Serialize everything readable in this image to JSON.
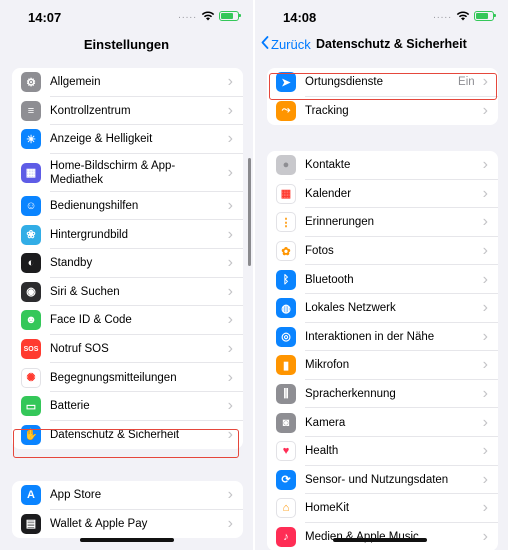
{
  "left": {
    "status": {
      "time": "14:07",
      "signal": "....."
    },
    "title": "Einstellungen",
    "group1": [
      {
        "label": "Allgemein",
        "icon": "gear-icon",
        "color": "#8e8e93"
      },
      {
        "label": "Kontrollzentrum",
        "icon": "toggles-icon",
        "color": "#8e8e93"
      },
      {
        "label": "Anzeige & Helligkeit",
        "icon": "sun-icon",
        "color": "#0a84ff"
      },
      {
        "label": "Home-Bildschirm & App-Mediathek",
        "icon": "app-grid-icon",
        "color": "#5e5ce6"
      },
      {
        "label": "Bedienungshilfen",
        "icon": "accessibility-icon",
        "color": "#0a84ff"
      },
      {
        "label": "Hintergrundbild",
        "icon": "flower-icon",
        "color": "#32ade6"
      },
      {
        "label": "Standby",
        "icon": "standby-icon",
        "color": "#1c1c1e"
      },
      {
        "label": "Siri & Suchen",
        "icon": "siri-icon",
        "color": "#2c2c2e"
      },
      {
        "label": "Face ID & Code",
        "icon": "face-id-icon",
        "color": "#34c759"
      },
      {
        "label": "Notruf SOS",
        "icon": "sos-icon",
        "color": "#ff3b30",
        "glyph": "SOS"
      },
      {
        "label": "Begegnungsmitteilungen",
        "icon": "exposure-icon",
        "color": "#ffffff"
      },
      {
        "label": "Batterie",
        "icon": "battery-icon",
        "color": "#34c759"
      },
      {
        "label": "Datenschutz & Sicherheit",
        "icon": "hand-icon",
        "color": "#0a84ff"
      }
    ],
    "group2": [
      {
        "label": "App Store",
        "icon": "app-store-icon",
        "color": "#0a84ff"
      },
      {
        "label": "Wallet & Apple Pay",
        "icon": "wallet-icon",
        "color": "#1c1c1e"
      }
    ]
  },
  "right": {
    "status": {
      "time": "14:08",
      "signal": "....."
    },
    "back_label": "Zurück",
    "title": "Datenschutz & Sicherheit",
    "group1": [
      {
        "label": "Ortungsdienste",
        "value": "Ein",
        "icon": "location-arrow-icon",
        "color": "#0a84ff"
      },
      {
        "label": "Tracking",
        "icon": "tracking-icon",
        "color": "#ff9500"
      }
    ],
    "group2": [
      {
        "label": "Kontakte",
        "icon": "contacts-icon",
        "color": "#c8c8cc"
      },
      {
        "label": "Kalender",
        "icon": "calendar-icon",
        "color": "#ffffff"
      },
      {
        "label": "Erinnerungen",
        "icon": "reminders-icon",
        "color": "#ffffff"
      },
      {
        "label": "Fotos",
        "icon": "photos-icon",
        "color": "#ffffff"
      },
      {
        "label": "Bluetooth",
        "icon": "bluetooth-icon",
        "color": "#0a84ff"
      },
      {
        "label": "Lokales Netzwerk",
        "icon": "globe-icon",
        "color": "#0a84ff"
      },
      {
        "label": "Interaktionen in der Nähe",
        "icon": "nearby-icon",
        "color": "#0a84ff"
      },
      {
        "label": "Mikrofon",
        "icon": "microphone-icon",
        "color": "#ff9500"
      },
      {
        "label": "Spracherkennung",
        "icon": "waveform-icon",
        "color": "#8e8e93"
      },
      {
        "label": "Kamera",
        "icon": "camera-icon",
        "color": "#8e8e93"
      },
      {
        "label": "Health",
        "icon": "heart-icon",
        "color": "#ffffff"
      },
      {
        "label": "Sensor- und Nutzungsdaten",
        "icon": "sensor-icon",
        "color": "#0a84ff"
      },
      {
        "label": "HomeKit",
        "icon": "home-icon",
        "color": "#ffffff"
      },
      {
        "label": "Medien & Apple Music",
        "icon": "music-icon",
        "color": "#ff2d55"
      }
    ]
  }
}
